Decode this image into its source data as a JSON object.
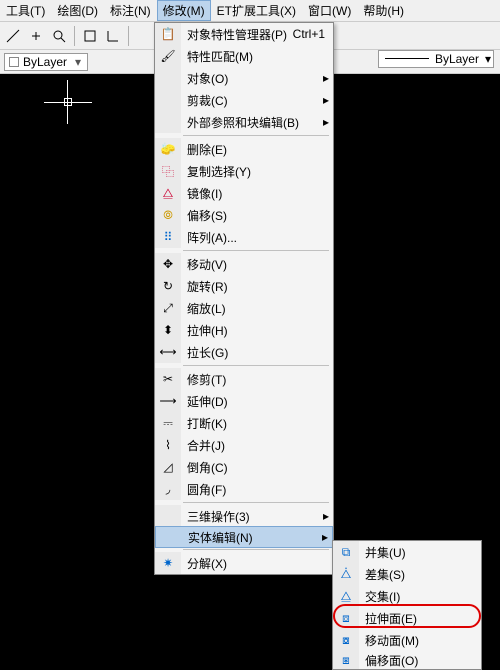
{
  "menubar": {
    "items": [
      {
        "label": "工具(T)"
      },
      {
        "label": "绘图(D)"
      },
      {
        "label": "标注(N)"
      },
      {
        "label": "修改(M)",
        "open": true
      },
      {
        "label": "ET扩展工具(X)"
      },
      {
        "label": "窗口(W)"
      },
      {
        "label": "帮助(H)"
      }
    ]
  },
  "propbar": {
    "bylayer1": "ByLayer",
    "bylayer2": "ByLayer"
  },
  "modify_menu": {
    "shortcut_props": "Ctrl+1",
    "items": [
      {
        "label": "对象特性管理器(P)",
        "icon": "props",
        "short": true
      },
      {
        "label": "特性匹配(M)",
        "icon": "match"
      },
      {
        "label": "对象(O)",
        "sub": true
      },
      {
        "label": "剪裁(C)",
        "sub": true
      },
      {
        "label": "外部参照和块编辑(B)",
        "sub": true
      },
      {
        "sep": true
      },
      {
        "label": "删除(E)",
        "icon": "erase"
      },
      {
        "label": "复制选择(Y)",
        "icon": "copy"
      },
      {
        "label": "镜像(I)",
        "icon": "mirror"
      },
      {
        "label": "偏移(S)",
        "icon": "offset"
      },
      {
        "label": "阵列(A)...",
        "icon": "array"
      },
      {
        "sep": true
      },
      {
        "label": "移动(V)",
        "icon": "move"
      },
      {
        "label": "旋转(R)",
        "icon": "rotate"
      },
      {
        "label": "缩放(L)",
        "icon": "scale"
      },
      {
        "label": "拉伸(H)",
        "icon": "stretch"
      },
      {
        "label": "拉长(G)",
        "icon": "lengthen"
      },
      {
        "sep": true
      },
      {
        "label": "修剪(T)",
        "icon": "trim"
      },
      {
        "label": "延伸(D)",
        "icon": "extend"
      },
      {
        "label": "打断(K)",
        "icon": "break"
      },
      {
        "label": "合并(J)",
        "icon": "join"
      },
      {
        "label": "倒角(C)",
        "icon": "chamfer"
      },
      {
        "label": "圆角(F)",
        "icon": "fillet"
      },
      {
        "sep": true
      },
      {
        "label": "三维操作(3)",
        "sub": true
      },
      {
        "label": "实体编辑(N)",
        "sub": true,
        "hover": true
      },
      {
        "sep": true
      },
      {
        "label": "分解(X)",
        "icon": "explode"
      }
    ]
  },
  "solid_edit_menu": {
    "items": [
      {
        "label": "并集(U)",
        "icon": "union"
      },
      {
        "label": "差集(S)",
        "icon": "subtract"
      },
      {
        "label": "交集(I)",
        "icon": "intersect"
      },
      {
        "label": "拉伸面(E)",
        "icon": "extrude-face",
        "circled": true
      },
      {
        "label": "移动面(M)",
        "icon": "move-face"
      },
      {
        "label": "偏移面(O)",
        "icon": "offset-face"
      }
    ]
  }
}
